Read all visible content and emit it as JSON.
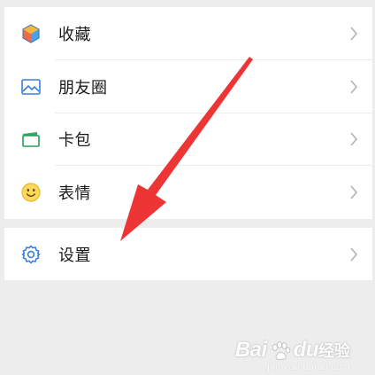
{
  "menu": {
    "items": [
      {
        "label": "收藏",
        "icon": "favorites-cube-icon"
      },
      {
        "label": "朋友圈",
        "icon": "moments-picture-icon"
      },
      {
        "label": "卡包",
        "icon": "card-wallet-icon"
      },
      {
        "label": "表情",
        "icon": "smiley-face-icon"
      }
    ],
    "settings": {
      "label": "设置",
      "icon": "gear-icon"
    }
  },
  "annotation": {
    "arrow_color": "#ee3535"
  },
  "watermark": {
    "brand": "Bai",
    "brand_suffix": "du",
    "cn": "经验",
    "url": "jingyan.baidu.com"
  }
}
